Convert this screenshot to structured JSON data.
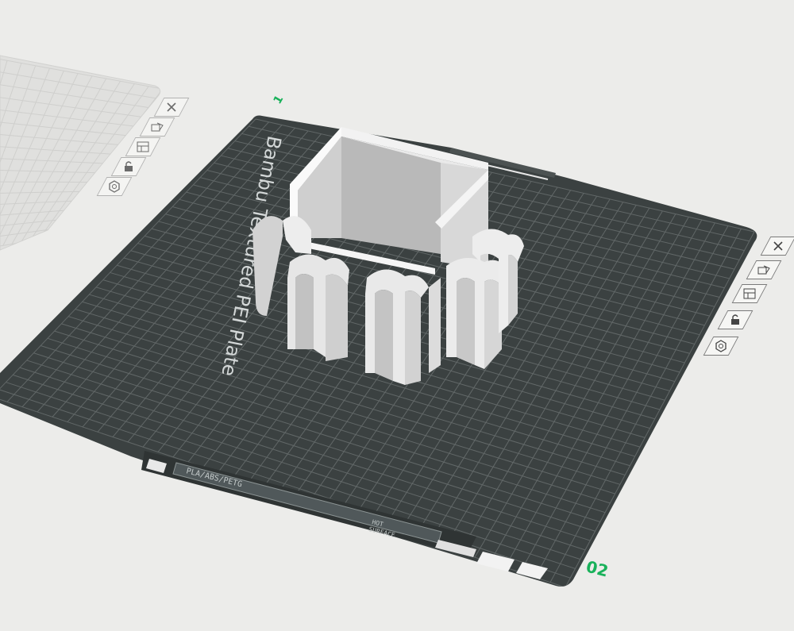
{
  "viewport": {
    "background_color": "#ececea",
    "plate_color": "#3b4141",
    "grid_color": "#6f7575",
    "model_color": "#cfcfcf",
    "accent_green": "#19b15a"
  },
  "active_plate": {
    "label": "Bambu Textured PEI Plate",
    "number": "02",
    "strip_text": "PLA/ABS/PETG",
    "hot_surface_text": [
      "HOT",
      "SURFACE"
    ]
  },
  "neighbor_plate": {
    "number": "1"
  },
  "plate_tools": [
    {
      "name": "close-plate",
      "icon": "close-icon"
    },
    {
      "name": "auto-orient",
      "icon": "auto-orient-icon"
    },
    {
      "name": "arrange",
      "icon": "arrange-icon"
    },
    {
      "name": "lock",
      "icon": "lock-icon"
    },
    {
      "name": "plate-settings",
      "icon": "gear-icon"
    }
  ]
}
